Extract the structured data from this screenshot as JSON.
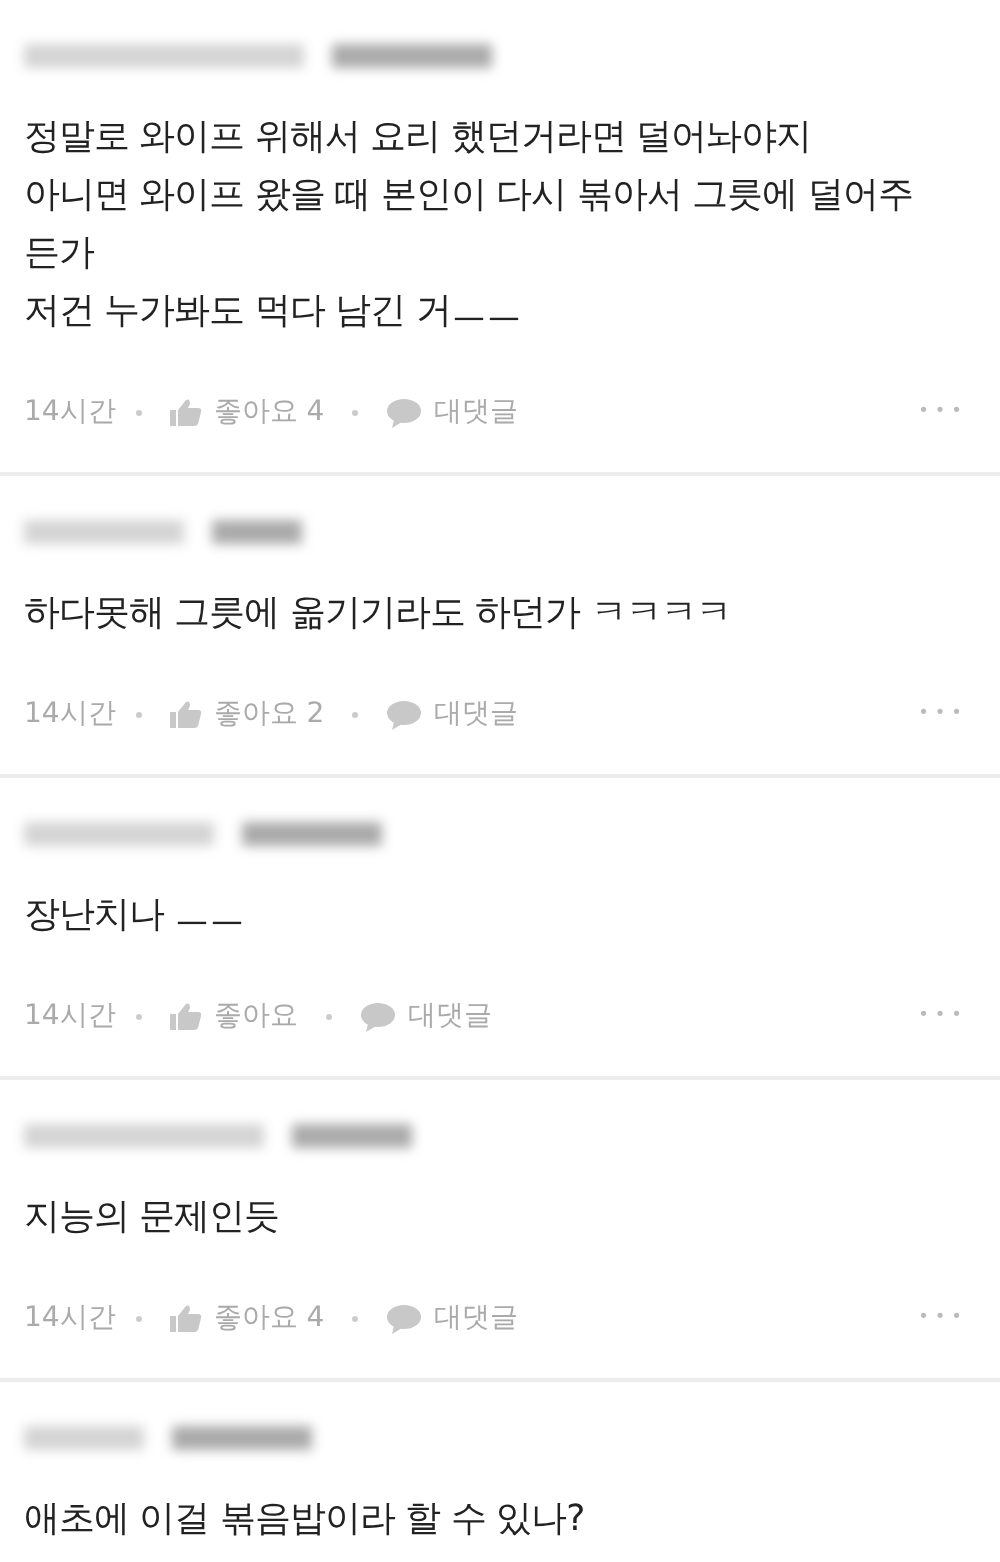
{
  "comments": [
    {
      "lines": [
        "정말로 와이프 위해서 요리 했던거라면 덜어놔야지",
        "아니면 와이프 왔을 때 본인이 다시 볶아서 그릇에 덜어주",
        "든가",
        "저건 누가봐도 먹다 남긴 거ㅡㅡ"
      ],
      "meta": {
        "time": "14시간",
        "like": "좋아요 4",
        "reply": "대댓글",
        "more": "•••"
      }
    },
    {
      "lines": [
        "하다못해 그릇에 옮기기라도 하던가 ㅋㅋㅋㅋ"
      ],
      "meta": {
        "time": "14시간",
        "like": "좋아요 2",
        "reply": "대댓글",
        "more": "•••"
      }
    },
    {
      "lines": [
        "장난치나 ㅡㅡ"
      ],
      "meta": {
        "time": "14시간",
        "like": "좋아요",
        "reply": "대댓글",
        "more": "•••"
      }
    },
    {
      "lines": [
        "지능의 문제인듯"
      ],
      "meta": {
        "time": "14시간",
        "like": "좋아요 4",
        "reply": "대댓글",
        "more": "•••"
      }
    },
    {
      "lines": [
        "애초에 이걸 볶음밥이라 할 수 있나?"
      ]
    }
  ]
}
